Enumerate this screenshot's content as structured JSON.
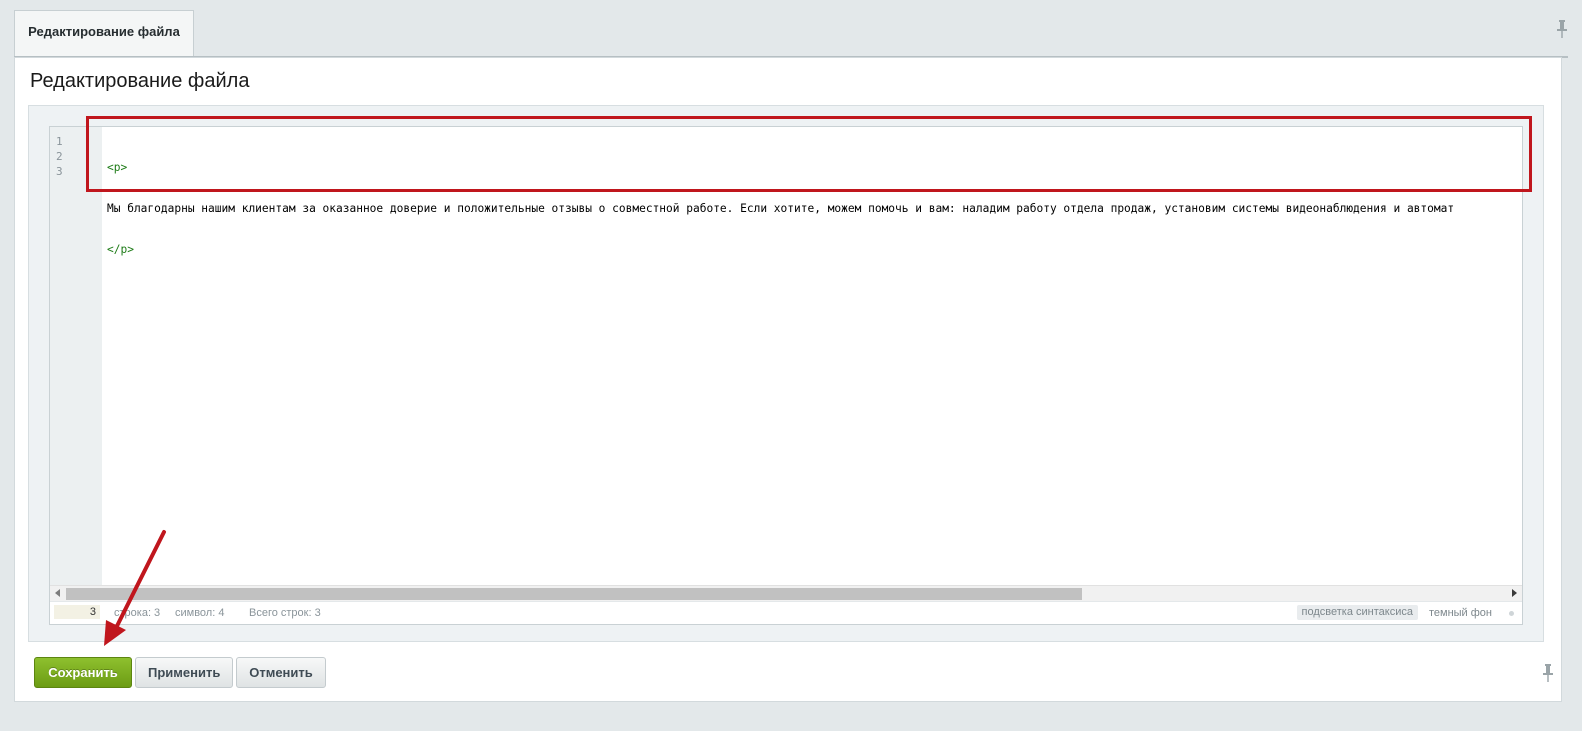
{
  "tab": {
    "label": "Редактирование файла"
  },
  "page": {
    "title": "Редактирование файла"
  },
  "editor": {
    "line_numbers": [
      "1",
      "2",
      "3"
    ],
    "lines": [
      {
        "kind": "tag",
        "text": "<p>"
      },
      {
        "kind": "text",
        "text": "Мы благодарны нашим клиентам за оказанное доверие и положительные отзывы о совместной работе. Если хотите, можем помочь и вам: наладим работу отдела продаж, установим системы видеонаблюдения и автомат"
      },
      {
        "kind": "tag",
        "text": "</p>"
      }
    ],
    "status": {
      "goto_line_value": "3",
      "line_label": "строка: 3",
      "char_label": "символ: 4",
      "total_label": "Всего строк: 3",
      "highlight_toggle": "подсветка синтаксиса",
      "dark_toggle": "темный фон"
    }
  },
  "buttons": {
    "save": "Сохранить",
    "apply": "Применить",
    "cancel": "Отменить"
  },
  "colors": {
    "annotation": "#c0161d",
    "save_button": "#7aab1e",
    "tag": "#1d7b17"
  },
  "icons": [
    "pin-icon",
    "annotation-arrow-icon"
  ]
}
